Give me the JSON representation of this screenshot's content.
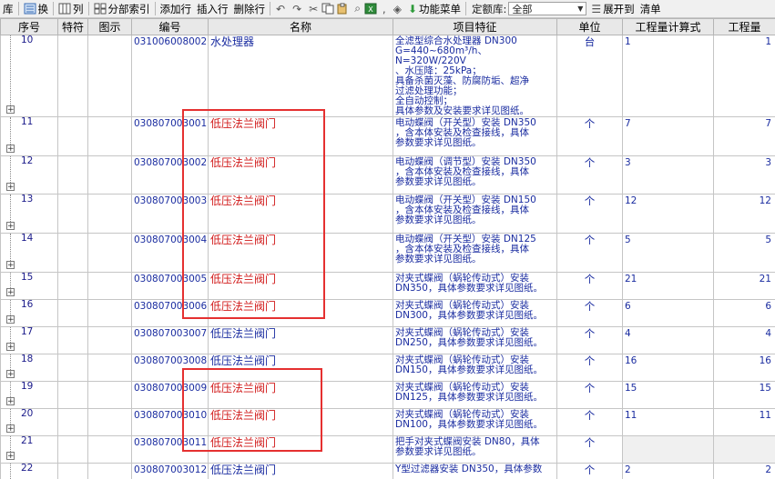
{
  "toolbar": {
    "lib_label": "库",
    "swap_label": "换",
    "column_label": "列",
    "index_label": "分部索引",
    "add_row_label": "添加行",
    "insert_row_label": "插入行",
    "delete_row_label": "删除行",
    "function_menu_label": "功能菜单",
    "quota_library_label": "定额库:",
    "quota_library_value": "全部",
    "expand_label": "展开到",
    "clear_label": "清单"
  },
  "columns": {
    "seq": "序号",
    "special": "特符",
    "diagram": "图示",
    "code": "编号",
    "name": "名称",
    "features": "项目特征",
    "unit": "单位",
    "expression": "工程量计算式",
    "quantity": "工程量"
  },
  "rows": [
    {
      "seq": "10",
      "code": "031006008002",
      "name": "水处理器",
      "features": [
        "全滤型综合水处理器 DN300",
        "G=440~680m³/h、N=320W/220V",
        "、水压降：25kPa；",
        "具备杀菌灭藻、防腐防垢、超净",
        "过滤处理功能；",
        "全自动控制；",
        "具体参数及安装要求详见图纸。"
      ],
      "unit": "台",
      "expr": "1",
      "qty": "1",
      "red": false
    },
    {
      "seq": "11",
      "code": "030807003001",
      "name": "低压法兰阀门",
      "features": [
        "电动蝶阀（开关型）安装 DN350",
        "，含本体安装及检查接线，具体",
        "参数要求详见图纸。"
      ],
      "unit": "个",
      "expr": "7",
      "qty": "7",
      "red": true
    },
    {
      "seq": "12",
      "code": "030807003002",
      "name": "低压法兰阀门",
      "features": [
        "电动蝶阀（调节型）安装 DN350",
        "，含本体安装及检查接线，具体",
        "参数要求详见图纸。"
      ],
      "unit": "个",
      "expr": "3",
      "qty": "3",
      "red": true
    },
    {
      "seq": "13",
      "code": "030807003003",
      "name": "低压法兰阀门",
      "features": [
        "电动蝶阀（开关型）安装 DN150",
        "，含本体安装及检查接线，具体",
        "参数要求详见图纸。"
      ],
      "unit": "个",
      "expr": "12",
      "qty": "12",
      "red": true
    },
    {
      "seq": "14",
      "code": "030807003004",
      "name": "低压法兰阀门",
      "features": [
        "电动蝶阀（开关型）安装 DN125",
        "，含本体安装及检查接线，具体",
        "参数要求详见图纸。"
      ],
      "unit": "个",
      "expr": "5",
      "qty": "5",
      "red": true
    },
    {
      "seq": "15",
      "code": "030807003005",
      "name": "低压法兰阀门",
      "features": [
        "对夹式蝶阀（蜗轮传动式）安装",
        "DN350，具体参数要求详见图纸。"
      ],
      "unit": "个",
      "expr": "21",
      "qty": "21",
      "red": true
    },
    {
      "seq": "16",
      "code": "030807003006",
      "name": "低压法兰阀门",
      "features": [
        "对夹式蝶阀（蜗轮传动式）安装",
        "DN300，具体参数要求详见图纸。"
      ],
      "unit": "个",
      "expr": "6",
      "qty": "6",
      "red": true
    },
    {
      "seq": "17",
      "code": "030807003007",
      "name": "低压法兰阀门",
      "features": [
        "对夹式蝶阀（蜗轮传动式）安装",
        "DN250，具体参数要求详见图纸。"
      ],
      "unit": "个",
      "expr": "4",
      "qty": "4",
      "red": false
    },
    {
      "seq": "18",
      "code": "030807003008",
      "name": "低压法兰阀门",
      "features": [
        "对夹式蝶阀（蜗轮传动式）安装",
        "DN150，具体参数要求详见图纸。"
      ],
      "unit": "个",
      "expr": "16",
      "qty": "16",
      "red": false
    },
    {
      "seq": "19",
      "code": "030807003009",
      "name": "低压法兰阀门",
      "features": [
        "对夹式蝶阀（蜗轮传动式）安装",
        "DN125，具体参数要求详见图纸。"
      ],
      "unit": "个",
      "expr": "15",
      "qty": "15",
      "red": true
    },
    {
      "seq": "20",
      "code": "030807003010",
      "name": "低压法兰阀门",
      "features": [
        "对夹式蝶阀（蜗轮传动式）安装",
        "DN100，具体参数要求详见图纸。"
      ],
      "unit": "个",
      "expr": "11",
      "qty": "11",
      "red": true
    },
    {
      "seq": "21",
      "code": "030807003011",
      "name": "低压法兰阀门",
      "features": [
        "把手对夹式蝶阀安装 DN80，具体",
        "参数要求详见图纸。"
      ],
      "unit": "个",
      "expr": "",
      "qty": "",
      "red": true
    },
    {
      "seq": "22",
      "code": "030807003012",
      "name": "低压法兰阀门",
      "features": [
        "Y型过滤器安装 DN350，具体参数"
      ],
      "unit": "个",
      "expr": "2",
      "qty": "2",
      "red": false
    }
  ],
  "colors": {
    "highlight": "#e53030",
    "text_blue": "#1a2ca0",
    "text_red": "#d11a1a",
    "header_bg": "#e8e8e8"
  }
}
